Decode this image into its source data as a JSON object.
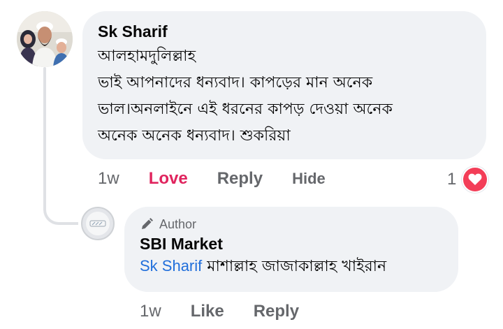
{
  "comment": {
    "author": "Sk Sharif",
    "text_lines": [
      "আলহামদুলিল্লাহ",
      "ভাই আপনাদের ধন্যবাদ। কাপড়ের মান অনেক",
      "ভাল।অনলাইনে এই ধরনের কাপড় দেওয়া অনেক",
      "অনেক অনেক ধন্যবাদ। শুকরিয়া"
    ],
    "timestamp": "1w",
    "love_label": "Love",
    "reply_label": "Reply",
    "hide_label": "Hide",
    "reaction_count": "1",
    "reaction_icon": "heart-icon",
    "love_color": "#f33e58"
  },
  "reply": {
    "badge": "Author",
    "badge_icon": "pen-icon",
    "author": "SBI Market",
    "mention": "Sk Sharif",
    "text": " মাশাল্লাহ জাজাকাল্লাহ খাইরান",
    "timestamp": "1w",
    "like_label": "Like",
    "reply_label": "Reply",
    "mention_color": "#216fdb"
  },
  "colors": {
    "bubble_bg": "#f0f2f5",
    "secondary_text": "#65676b",
    "love_text": "#e0245e"
  }
}
